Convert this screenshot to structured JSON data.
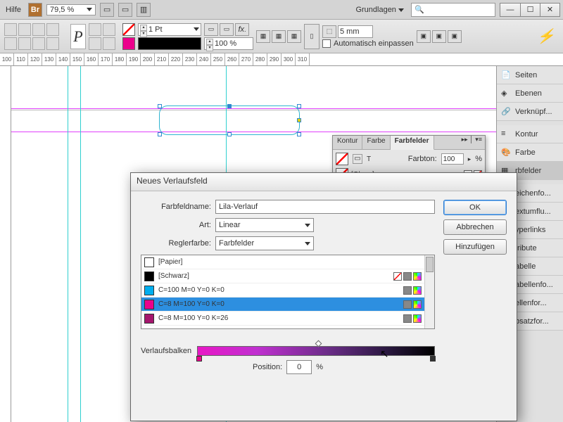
{
  "topbar": {
    "help": "Hilfe",
    "br": "Br",
    "zoom": "79,5 %",
    "center": "Grundlagen",
    "search_ph": ""
  },
  "toolbar": {
    "pt": "1 Pt",
    "pct": "100 %",
    "mm": "5 mm",
    "auto": "Automatisch einpassen"
  },
  "ruler": [
    "100",
    "110",
    "120",
    "130",
    "140",
    "150",
    "160",
    "170",
    "180",
    "190",
    "200",
    "210",
    "220",
    "230",
    "240",
    "250",
    "260",
    "270",
    "280",
    "290",
    "300",
    "310"
  ],
  "rpanel": {
    "items": [
      "Seiten",
      "Ebenen",
      "Verknüpf...",
      "Kontur",
      "Farbe",
      "rbfelder",
      "eichenfo...",
      "extumflu...",
      "yperlinks",
      "tribute",
      "abelle",
      "abellenfo...",
      "ellenfor...",
      "bsatzfor..."
    ]
  },
  "ffpanel": {
    "tabs": [
      "Kontur",
      "Farbe",
      "Farbfelder"
    ],
    "farbton_label": "Farbton:",
    "farbton": "100",
    "pct": "%",
    "row": "[Ohn...]"
  },
  "dialog": {
    "title": "Neues Verlaufsfeld",
    "name_label": "Farbfeldname:",
    "name": "Lila-Verlauf",
    "art_label": "Art:",
    "art": "Linear",
    "regler_label": "Reglerfarbe:",
    "regler": "Farbfelder",
    "swatches": [
      {
        "c": "#ffffff",
        "n": "[Papier]",
        "icons": 0
      },
      {
        "c": "#000000",
        "n": "[Schwarz]",
        "icons": 2
      },
      {
        "c": "#00aeef",
        "n": "C=100 M=0 Y=0 K=0",
        "icons": 1
      },
      {
        "c": "#ec008c",
        "n": "C=8 M=100 Y=0 K=0",
        "icons": 1,
        "sel": true
      },
      {
        "c": "#a5166e",
        "n": "C=8 M=100 Y=0 K=26",
        "icons": 1
      }
    ],
    "grad_label": "Verlaufsbalken",
    "pos_label": "Position:",
    "pos": "0",
    "pos_unit": "%",
    "ok": "OK",
    "cancel": "Abbrechen",
    "add": "Hinzufügen"
  }
}
